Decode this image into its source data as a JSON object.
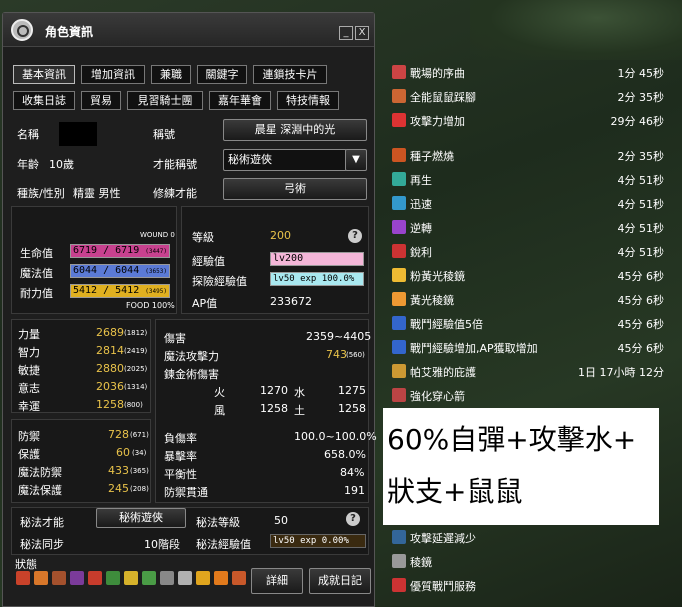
{
  "window": {
    "title": "角色資訊",
    "minimize": "_",
    "close": "X"
  },
  "tabs_row1": [
    "基本資訊",
    "增加資訊",
    "兼職",
    "關鍵字",
    "連鎖技卡片"
  ],
  "tabs_row2": [
    "收集日誌",
    "貿易",
    "見習騎士團",
    "嘉年華會",
    "特技情報"
  ],
  "profile": {
    "name_label": "名稱",
    "title_label": "稱號",
    "title_value": "晨星 深淵中的光",
    "age_label": "年齡",
    "age_value": "10歲",
    "talent_title_label": "才能稱號",
    "talent_title_value": "秘術遊俠",
    "race_label": "種族/性別",
    "race_value": "精靈 男性",
    "training_label": "修練才能",
    "training_value": "弓術"
  },
  "vitals": {
    "wound": "WOUND 0",
    "hp_label": "生命值",
    "hp": "6719 / 6719",
    "hp_base": "(3447)",
    "mp_label": "魔法值",
    "mp": "6044 / 6044",
    "mp_base": "(3653)",
    "sp_label": "耐力值",
    "sp": "5412 / 5412",
    "sp_base": "(3495)",
    "food": "FOOD 100%"
  },
  "level": {
    "level_label": "等級",
    "level_value": "200",
    "exp_label": "經驗值",
    "exp_value": "lv200",
    "explore_label": "探險經驗值",
    "explore_value": "lv50 exp 100.0%",
    "ap_label": "AP值",
    "ap_value": "233672"
  },
  "stats": [
    {
      "label": "力量",
      "value": "2689",
      "base": "(1812)"
    },
    {
      "label": "智力",
      "value": "2814",
      "base": "(2419)"
    },
    {
      "label": "敏捷",
      "value": "2880",
      "base": "(2025)"
    },
    {
      "label": "意志",
      "value": "2036",
      "base": "(1314)"
    },
    {
      "label": "幸運",
      "value": "1258",
      "base": "(800)"
    }
  ],
  "defense": [
    {
      "label": "防禦",
      "value": "728",
      "base": "(671)"
    },
    {
      "label": "保護",
      "value": "60",
      "base": "(34)"
    },
    {
      "label": "魔法防禦",
      "value": "433",
      "base": "(365)"
    },
    {
      "label": "魔法保護",
      "value": "245",
      "base": "(208)"
    }
  ],
  "damage": {
    "damage_label": "傷害",
    "damage_value": "2359~4405",
    "magic_label": "魔法攻擊力",
    "magic_value": "743",
    "magic_base": "(560)",
    "alchemy_label": "鍊金術傷害",
    "fire": "火",
    "fire_val": "1270",
    "water": "水",
    "water_val": "1275",
    "wind": "風",
    "wind_val": "1258",
    "earth": "土",
    "earth_val": "1258"
  },
  "rates": [
    {
      "label": "負傷率",
      "value": "100.0~100.0%"
    },
    {
      "label": "暴擊率",
      "value": "658.0%"
    },
    {
      "label": "平衡性",
      "value": "84%"
    },
    {
      "label": "防禦貫通",
      "value": "191"
    }
  ],
  "secret": {
    "talent_label": "秘法才能",
    "talent_value": "秘術遊俠",
    "level_label": "秘法等級",
    "level_value": "50",
    "sync_label": "秘法同步",
    "sync_value": "10階段",
    "exp_label": "秘法經驗值",
    "exp_value": "lv50 exp 0.00%"
  },
  "status": {
    "label": "狀態",
    "detail_button": "詳細",
    "growth_button": "成就日記"
  },
  "buffs": [
    {
      "name": "戰場的序曲",
      "time": "1分 45秒"
    },
    {
      "name": "全能鼠鼠踩腳",
      "time": "2分 35秒"
    },
    {
      "name": "攻擊力增加",
      "time": "29分 46秒"
    },
    {
      "name": "種子燃燒",
      "time": "2分 35秒"
    },
    {
      "name": "再生",
      "time": "4分 51秒"
    },
    {
      "name": "迅速",
      "time": "4分 51秒"
    },
    {
      "name": "逆轉",
      "time": "4分 51秒"
    },
    {
      "name": "銳利",
      "time": "4分 51秒"
    },
    {
      "name": "粉黃光稜鏡",
      "time": "45分 6秒"
    },
    {
      "name": "黃光稜鏡",
      "time": "45分 6秒"
    },
    {
      "name": "戰鬥經驗值5倍",
      "time": "45分 6秒"
    },
    {
      "name": "戰鬥經驗增加,AP獲取增加",
      "time": "45分 6秒"
    },
    {
      "name": "帕艾雅的庇護",
      "time": "1日 17小時 12分"
    },
    {
      "name": "強化穿心箭",
      "time": ""
    },
    {
      "name": "攻擊延遲減少",
      "time": ""
    },
    {
      "name": "稜鏡",
      "time": ""
    },
    {
      "name": "優質戰鬥服務",
      "time": ""
    }
  ],
  "note": {
    "line1": "60%自彈+攻擊水+",
    "line2": "狀支+鼠鼠"
  },
  "colors": {
    "hp": "#c8418f",
    "mp": "#5b7ad6",
    "sp": "#e0b020",
    "exp": "#f4b6d8",
    "explore": "#a9e8f0",
    "gold": "#e8c24a"
  }
}
